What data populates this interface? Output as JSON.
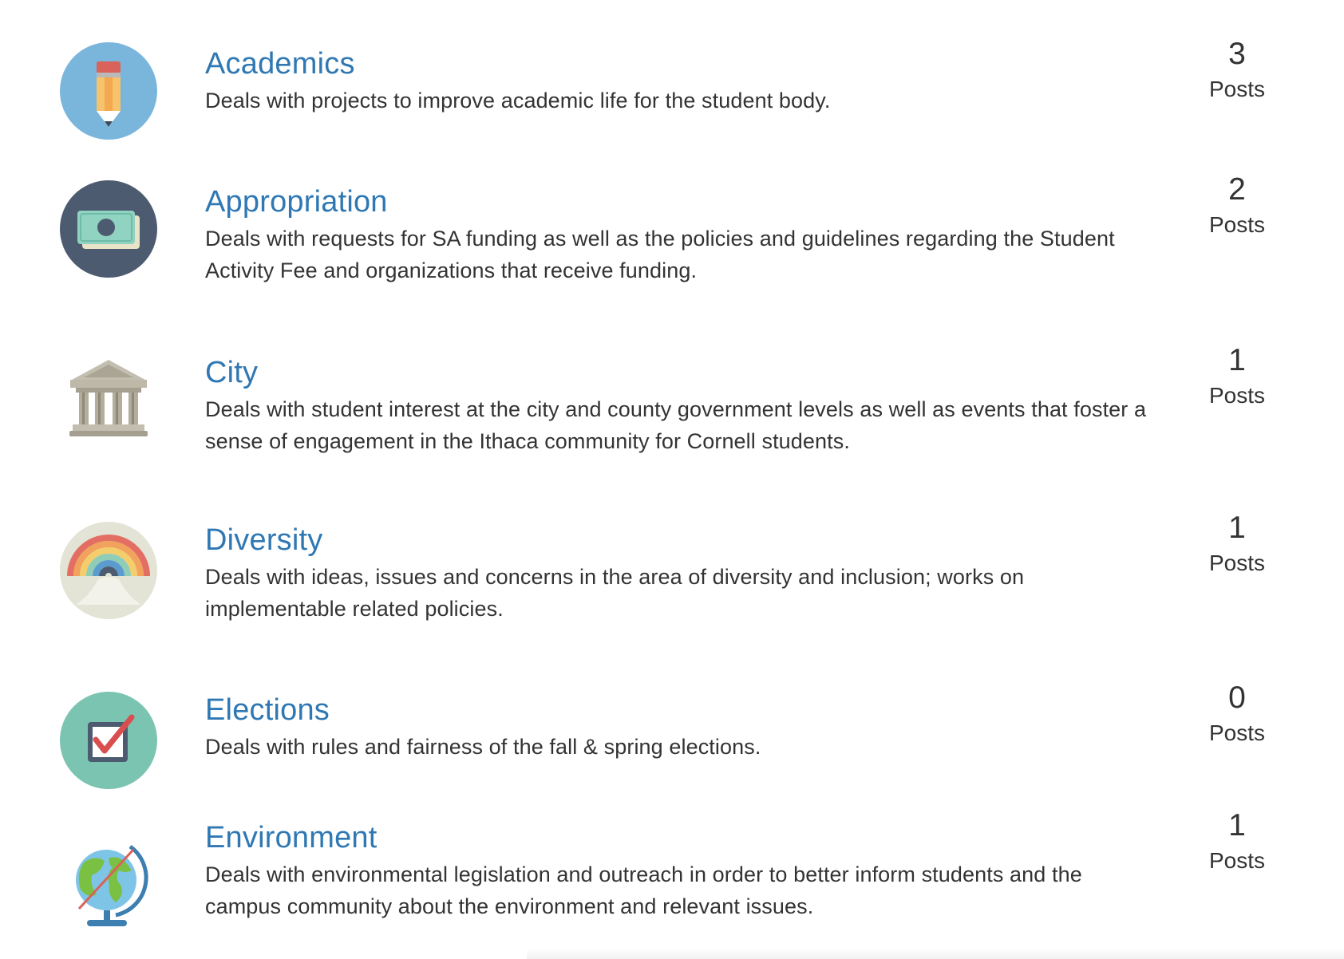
{
  "categories": [
    {
      "icon": "pencil-icon",
      "title": "Academics",
      "description": "Deals with projects to improve academic life for the student body.",
      "count": "3",
      "count_label": "Posts"
    },
    {
      "icon": "money-icon",
      "title": "Appropriation",
      "description": "Deals with requests for SA funding as well as the policies and guidelines regarding the Student Activity Fee and organizations that receive funding.",
      "count": "2",
      "count_label": "Posts"
    },
    {
      "icon": "government-building-icon",
      "title": "City",
      "description": "Deals with student interest at the city and county government levels as well as events that foster a sense of engagement in the Ithaca community for Cornell students.",
      "count": "1",
      "count_label": "Posts"
    },
    {
      "icon": "rainbow-icon",
      "title": "Diversity",
      "description": "Deals with ideas, issues and concerns in the area of diversity and inclusion; works on implementable related policies.",
      "count": "1",
      "count_label": "Posts"
    },
    {
      "icon": "ballot-checkbox-icon",
      "title": "Elections",
      "description": "Deals with rules and fairness of the fall & spring elections.",
      "count": "0",
      "count_label": "Posts"
    },
    {
      "icon": "globe-icon",
      "title": "Environment",
      "description": "Deals with environmental legislation and outreach in order to better inform students and the campus community about the environment and relevant issues.",
      "count": "1",
      "count_label": "Posts"
    }
  ],
  "colors": {
    "link": "#2f78b4",
    "text": "#333333",
    "academics_circle": "#7ab6dc",
    "appropriation_circle": "#4d5b70",
    "diversity_circle": "#e3e3d6",
    "elections_circle": "#7cc4b2"
  }
}
